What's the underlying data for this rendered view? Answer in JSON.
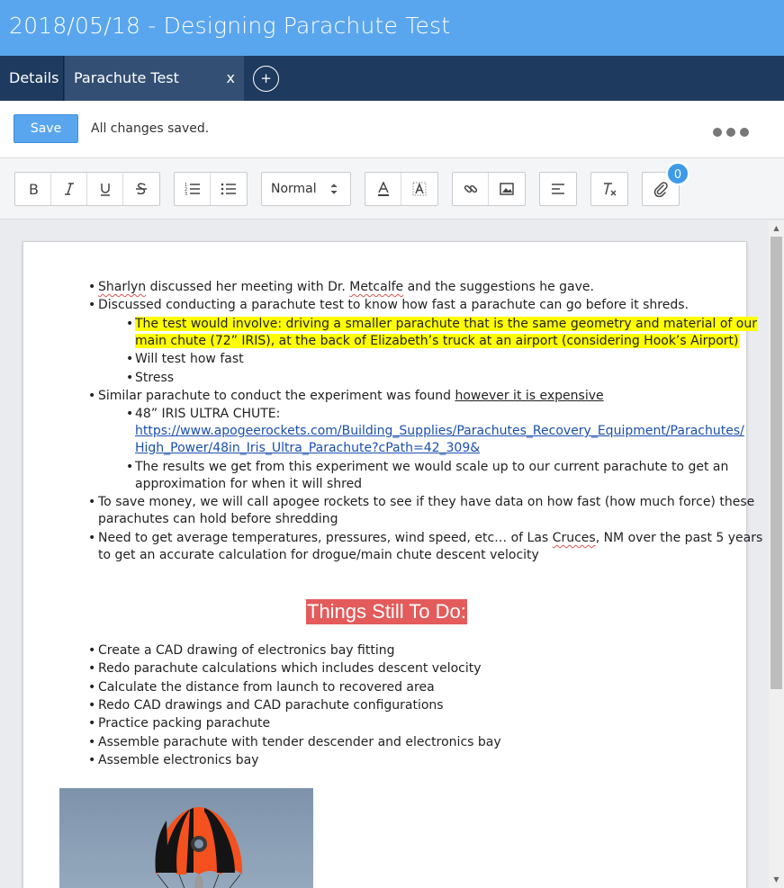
{
  "window": {
    "title": "2018/05/18 - Designing Parachute Test"
  },
  "tabs": {
    "details_label": "Details",
    "active_label": "Parachute Test",
    "close_label": "x",
    "add_label": "+"
  },
  "savebar": {
    "save_label": "Save",
    "status": "All changes saved."
  },
  "toolbar": {
    "format_select_value": "Normal",
    "attachment_count": "0",
    "buttons": [
      "bold-icon",
      "italic-icon",
      "underline-icon",
      "strikethrough-icon",
      "ordered-list-icon",
      "bullet-list-icon",
      "text-color-icon",
      "background-color-icon",
      "link-icon",
      "image-icon",
      "align-left-icon",
      "clear-format-icon",
      "paperclip-icon"
    ]
  },
  "doc": {
    "b1": {
      "pre": "",
      "w1": "Sharlyn",
      "mid": " discussed her meeting with Dr. ",
      "w2": "Metcalfe",
      "post": " and the suggestions he gave."
    },
    "b2": "Discussed conducting a parachute test to know how fast a parachute can go before it shreds.",
    "b2a_line1": "The test would involve: driving a smaller parachute that is the same geometry and material of our",
    "b2a_line2": "main chute (72” IRIS), at the back of Elizabeth’s truck at an airport (considering Hook’s Airport)",
    "b2b": "Will test how fast",
    "b2c": "Stress",
    "b3_pre": "Similar parachute to conduct the experiment was found ",
    "b3_ul": "however it is expensive",
    "b3a_label": "48” IRIS ULTRA CHUTE:",
    "b3a_link_line1": "https://www.apogeerockets.com/Building_Supplies/Parachutes_Recovery_Equipment/Parachutes/",
    "b3a_link_line2": "High_Power/48in_Iris_Ultra_Parachute?cPath=42_309&",
    "b3b_line1": "The results we get from this experiment we would scale up to our current parachute to get an",
    "b3b_line2": "approximation for when it will shred",
    "b4_line1": "To save money, we will call apogee rockets to see if they have data on how fast (how much force) these",
    "b4_line2": "parachutes can hold before shredding",
    "b5_line1_pre": "Need to get average temperatures, pressures, wind speed, etc… of Las ",
    "b5_line1_sq": "Cruces",
    "b5_line1_post": ", NM over the past 5 years",
    "b5_line2": "to get an accurate calculation for drogue/main chute descent velocity",
    "heading": "Things Still To Do:",
    "todo": [
      "Create a CAD drawing of electronics bay fitting",
      "Redo parachute calculations which includes descent velocity",
      "Calculate the distance from launch to recovered area",
      "Redo CAD drawings and CAD parachute configurations",
      "Practice packing parachute",
      "Assemble parachute with tender descender and electronics bay",
      "Assemble electronics bay"
    ],
    "bullet": "•"
  },
  "colors": {
    "titlebar": "#5aa6ee",
    "tabbar": "#1e3a5f",
    "active_tab": "#334f74",
    "highlight": "#ffff00",
    "heading_bg": "#e35b5b",
    "parachute_orange": "#f4511e"
  }
}
